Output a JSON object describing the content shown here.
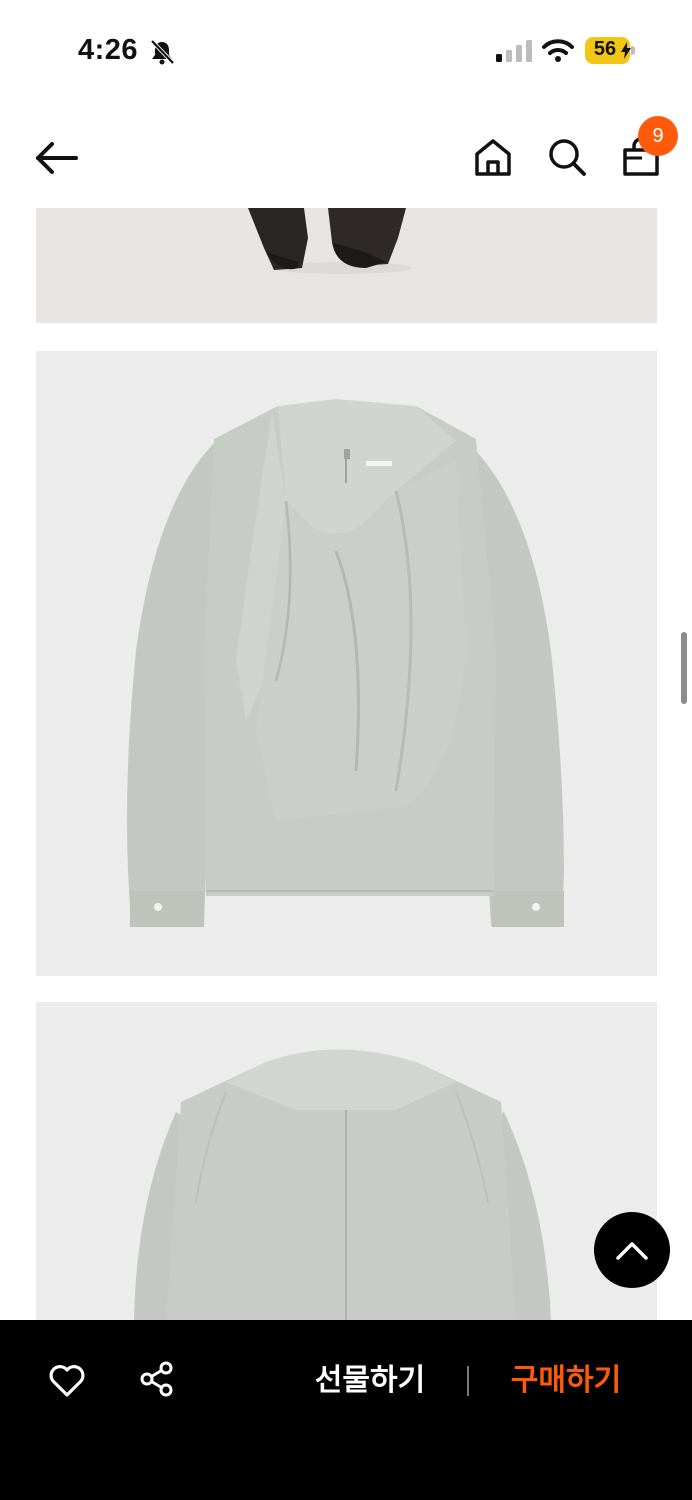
{
  "status_bar": {
    "time": "4:26",
    "battery": "56",
    "icons": [
      "bell-slash-icon",
      "cellular-signal-icon",
      "wifi-icon",
      "battery-charging-icon"
    ]
  },
  "header": {
    "icons": [
      "arrow-left-icon",
      "home-icon",
      "search-icon",
      "shopping-bag-icon"
    ],
    "cart_count": "9",
    "badge_color": "#ff5a0a"
  },
  "gallery": {
    "images": [
      "model-legs-photo",
      "blouse-front-photo",
      "blouse-back-photo"
    ],
    "background_color": "#ececec",
    "garment_color": "#c7cbc5"
  },
  "scroll_top_icon": "chevron-up-icon",
  "bottom_bar": {
    "like_icon": "heart-icon",
    "share_icon": "share-icon",
    "gift_label": "선물하기",
    "buy_label": "구매하기",
    "buy_color": "#ff5a0a"
  }
}
